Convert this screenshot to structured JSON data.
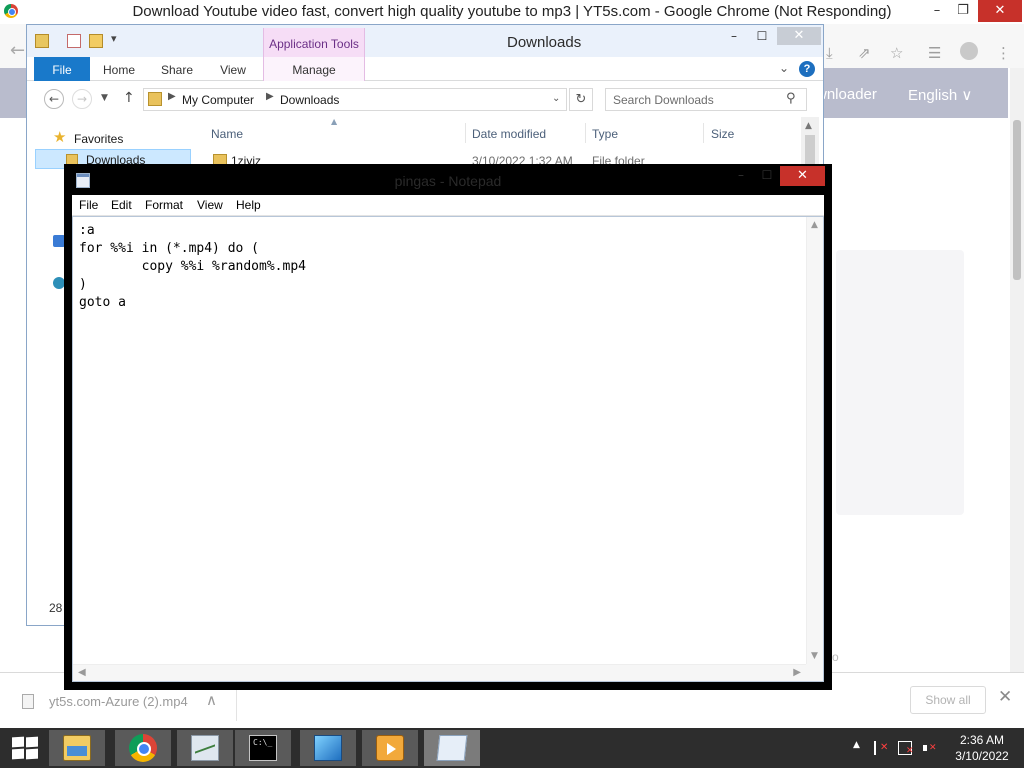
{
  "chrome": {
    "title": "Download Youtube video fast, convert high quality youtube to mp3 | YT5s.com - Google Chrome (Not Responding)",
    "minimize_icon": "minimize-icon",
    "restore_icon": "restore-icon",
    "close_icon": "close-icon",
    "site_nav": {
      "downloader_link": "wnloader",
      "language": "English ∨"
    },
    "site_fragment": "so",
    "download_bar": {
      "item_name": "yt5s.com-Azure (2).mp4",
      "chevron": "∧",
      "show_all": "Show all",
      "close": "✕"
    }
  },
  "explorer": {
    "title": "Downloads",
    "contextual_tab_group": "Application Tools",
    "ribbon_tabs": [
      "File",
      "Home",
      "Share",
      "View",
      "Manage"
    ],
    "address_path": [
      "My Computer",
      "Downloads"
    ],
    "search_placeholder": "Search Downloads",
    "nav_pane": {
      "favorites": "Favorites",
      "downloads": "Downloads"
    },
    "columns": [
      "Name",
      "Date modified",
      "Type",
      "Size"
    ],
    "files": [
      {
        "name": "1zjyjz",
        "date_modified": "3/10/2022 1:32 AM",
        "type": "File folder",
        "size": ""
      }
    ],
    "status_item_count": "28"
  },
  "notepad": {
    "title": "pingas - Notepad",
    "menu": [
      "File",
      "Edit",
      "Format",
      "View",
      "Help"
    ],
    "content": ":a\nfor %%i in (*.mp4) do (\n        copy %%i %random%.mp4\n)\ngoto a"
  },
  "taskbar": {
    "pinned_apps": [
      "file-explorer",
      "google-chrome",
      "performance-monitor",
      "command-prompt",
      "vsdc-video-editor",
      "media-player",
      "notepad"
    ],
    "active_app": "notepad",
    "clock_time": "2:36 AM",
    "clock_date": "3/10/2022"
  },
  "colors": {
    "taskbar_bg": "#2d2d2d",
    "notepad_frame": "#000000",
    "close_button_red": "#c7312a",
    "ribbon_file_tab": "#1979ca",
    "application_tools_tab": "#f6ddf6",
    "site_nav_bg": "#b9bccd"
  }
}
